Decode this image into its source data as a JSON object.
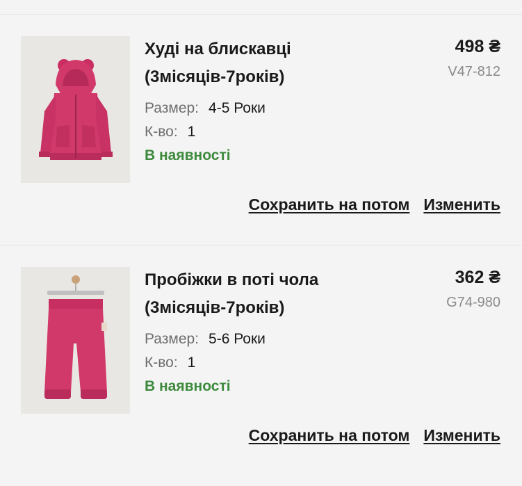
{
  "colors": {
    "in_stock": "#3d8a3d",
    "product_pink": "#d2396b"
  },
  "cart_items": [
    {
      "title": "Худі на блискавці (3місяців-7років)",
      "price": "498 ₴",
      "sku": "V47-812",
      "size_label": "Размер:",
      "size_value": "4-5 Роки",
      "qty_label": "К-во:",
      "qty_value": "1",
      "stock": "В наявності",
      "save_later": "Сохранить на потом",
      "edit": "Изменить",
      "image_icon": "pink-zip-hoodie"
    },
    {
      "title": "Пробіжки в поті чола (3місяців-7років)",
      "price": "362 ₴",
      "sku": "G74-980",
      "size_label": "Размер:",
      "size_value": "5-6 Роки",
      "qty_label": "К-во:",
      "qty_value": "1",
      "stock": "В наявності",
      "save_later": "Сохранить на потом",
      "edit": "Изменить",
      "image_icon": "pink-joggers"
    }
  ]
}
